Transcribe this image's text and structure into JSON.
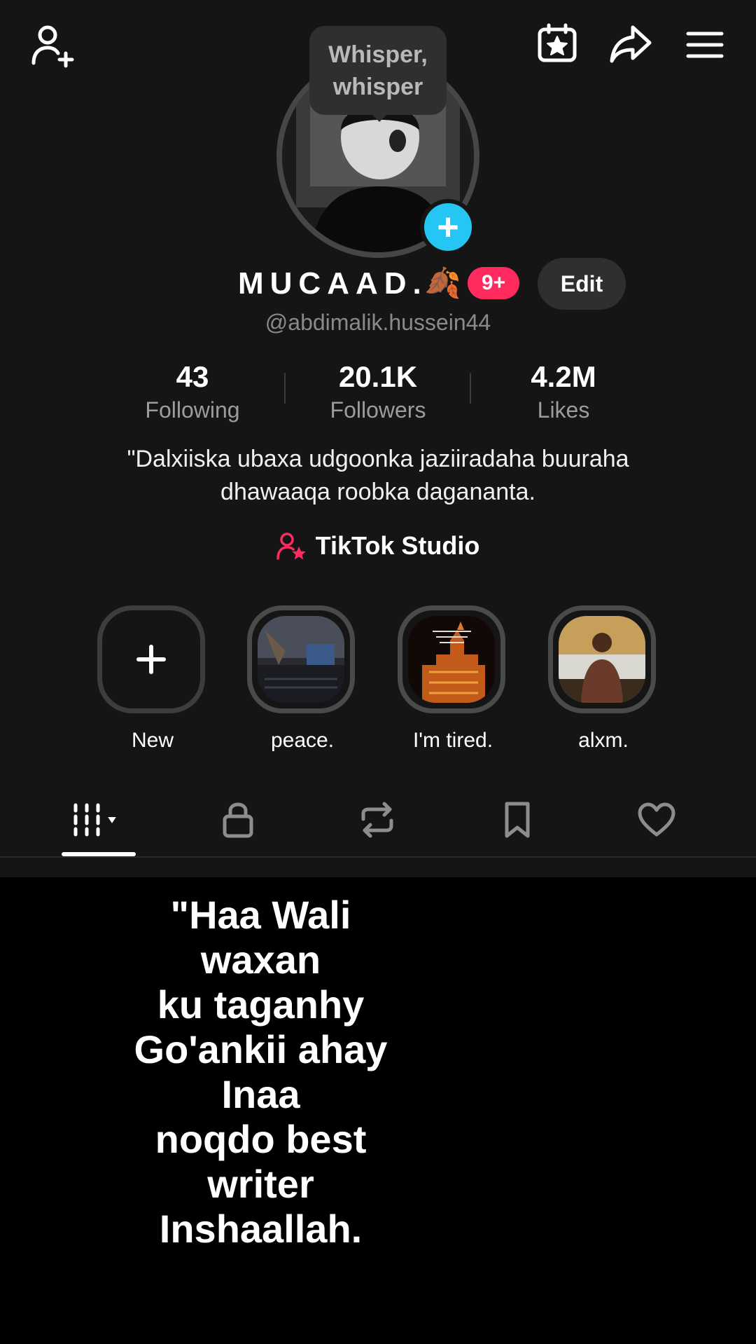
{
  "tooltip": {
    "line1": "Whisper,",
    "line2": "whisper"
  },
  "profile": {
    "display_name": "MUCAAD.",
    "name_emoji": "🍂",
    "notification_badge": "9+",
    "edit_label": "Edit",
    "handle": "@abdimalik.hussein44",
    "stats": {
      "following": {
        "value": "43",
        "label": "Following"
      },
      "followers": {
        "value": "20.1K",
        "label": "Followers"
      },
      "likes": {
        "value": "4.2M",
        "label": "Likes"
      }
    },
    "bio_line1": "\"Dalxiiska ubaxa udgoonka jaziiradaha buuraha",
    "bio_line2": "dhawaaqa roobka dagananta.",
    "studio_label": "TikTok Studio"
  },
  "highlights": [
    {
      "label": "New"
    },
    {
      "label": "peace."
    },
    {
      "label": "I'm tired."
    },
    {
      "label": "alxm."
    }
  ],
  "tabs": [
    "videos-grid",
    "private",
    "reposts",
    "favorites",
    "liked"
  ],
  "quote_text": "\"Haa Wali\nwaxan\nku taganhy\nGo'ankii ahay\nInaa\nnoqdo best\nwriter\nInshaallah.",
  "colors": {
    "accent_pink": "#ff2a5d",
    "avatar_add_blue": "#25c6f4",
    "background": "#151515"
  }
}
